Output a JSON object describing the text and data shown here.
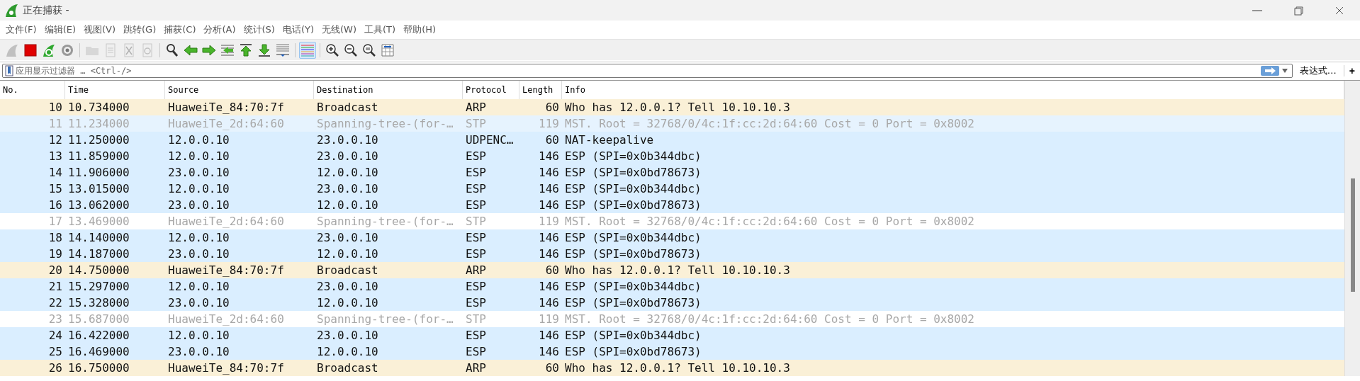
{
  "window": {
    "title": "正在捕获 -"
  },
  "menu": [
    "文件(F)",
    "编辑(E)",
    "视图(V)",
    "跳转(G)",
    "捕获(C)",
    "分析(A)",
    "统计(S)",
    "电话(Y)",
    "无线(W)",
    "工具(T)",
    "帮助(H)"
  ],
  "toolbar": [
    [
      {
        "disabled": true,
        "on": false
      },
      {
        "disabled": false,
        "on": false
      },
      {
        "disabled": false,
        "on": false
      },
      {
        "disabled": false,
        "on": false
      }
    ],
    [
      {
        "disabled": true,
        "on": false
      },
      {
        "disabled": true,
        "on": false
      },
      {
        "disabled": true,
        "on": false
      },
      {
        "disabled": true,
        "on": false
      }
    ],
    [
      {
        "disabled": false,
        "on": false
      },
      {
        "disabled": false,
        "on": false
      },
      {
        "disabled": false,
        "on": false
      },
      {
        "disabled": false,
        "on": false
      },
      {
        "disabled": false,
        "on": false
      },
      {
        "disabled": false,
        "on": false
      },
      {
        "disabled": false,
        "on": false
      }
    ],
    [
      {
        "disabled": false,
        "on": true
      }
    ],
    [
      {
        "disabled": false,
        "on": false
      },
      {
        "disabled": false,
        "on": false
      },
      {
        "disabled": false,
        "on": false
      },
      {
        "disabled": false,
        "on": false
      }
    ]
  ],
  "filter": {
    "placeholder": "应用显示过滤器 … <Ctrl-/>",
    "expression_button": "表达式…",
    "add_button": "+"
  },
  "table": {
    "columns": [
      "No.",
      "Time",
      "Source",
      "Destination",
      "Protocol",
      "Length",
      "Info"
    ],
    "rows": [
      {
        "cells": [
          "10",
          "10.734000",
          "HuaweiTe_84:70:7f",
          "Broadcast",
          "ARP",
          "60",
          "Who has 12.0.0.1? Tell 10.10.10.3"
        ],
        "color": "#faf0d7",
        "dimmed": false
      },
      {
        "cells": [
          "11",
          "11.234000",
          "HuaweiTe_2d:64:60",
          "Spanning-tree-(for-…",
          "STP",
          "119",
          "MST. Root = 32768/0/4c:1f:cc:2d:64:60  Cost = 0  Port = 0x8002"
        ],
        "color": "#e6f3fe",
        "dimmed": true
      },
      {
        "cells": [
          "12",
          "11.250000",
          "12.0.0.10",
          "23.0.0.10",
          "UDPENC…",
          "60",
          "NAT-keepalive"
        ],
        "color": "#daeeff",
        "dimmed": false
      },
      {
        "cells": [
          "13",
          "11.859000",
          "12.0.0.10",
          "23.0.0.10",
          "ESP",
          "146",
          "ESP (SPI=0x0b344dbc)"
        ],
        "color": "#daeeff",
        "dimmed": false
      },
      {
        "cells": [
          "14",
          "11.906000",
          "23.0.0.10",
          "12.0.0.10",
          "ESP",
          "146",
          "ESP (SPI=0x0bd78673)"
        ],
        "color": "#daeeff",
        "dimmed": false
      },
      {
        "cells": [
          "15",
          "13.015000",
          "12.0.0.10",
          "23.0.0.10",
          "ESP",
          "146",
          "ESP (SPI=0x0b344dbc)"
        ],
        "color": "#daeeff",
        "dimmed": false
      },
      {
        "cells": [
          "16",
          "13.062000",
          "23.0.0.10",
          "12.0.0.10",
          "ESP",
          "146",
          "ESP (SPI=0x0bd78673)"
        ],
        "color": "#daeeff",
        "dimmed": false
      },
      {
        "cells": [
          "17",
          "13.469000",
          "HuaweiTe_2d:64:60",
          "Spanning-tree-(for-…",
          "STP",
          "119",
          "MST. Root = 32768/0/4c:1f:cc:2d:64:60  Cost = 0  Port = 0x8002"
        ],
        "color": "#ffffff",
        "dimmed": true
      },
      {
        "cells": [
          "18",
          "14.140000",
          "12.0.0.10",
          "23.0.0.10",
          "ESP",
          "146",
          "ESP (SPI=0x0b344dbc)"
        ],
        "color": "#daeeff",
        "dimmed": false
      },
      {
        "cells": [
          "19",
          "14.187000",
          "23.0.0.10",
          "12.0.0.10",
          "ESP",
          "146",
          "ESP (SPI=0x0bd78673)"
        ],
        "color": "#daeeff",
        "dimmed": false
      },
      {
        "cells": [
          "20",
          "14.750000",
          "HuaweiTe_84:70:7f",
          "Broadcast",
          "ARP",
          "60",
          "Who has 12.0.0.1? Tell 10.10.10.3"
        ],
        "color": "#faf0d7",
        "dimmed": false
      },
      {
        "cells": [
          "21",
          "15.297000",
          "12.0.0.10",
          "23.0.0.10",
          "ESP",
          "146",
          "ESP (SPI=0x0b344dbc)"
        ],
        "color": "#daeeff",
        "dimmed": false
      },
      {
        "cells": [
          "22",
          "15.328000",
          "23.0.0.10",
          "12.0.0.10",
          "ESP",
          "146",
          "ESP (SPI=0x0bd78673)"
        ],
        "color": "#daeeff",
        "dimmed": false
      },
      {
        "cells": [
          "23",
          "15.687000",
          "HuaweiTe_2d:64:60",
          "Spanning-tree-(for-…",
          "STP",
          "119",
          "MST. Root = 32768/0/4c:1f:cc:2d:64:60  Cost = 0  Port = 0x8002"
        ],
        "color": "#ffffff",
        "dimmed": true
      },
      {
        "cells": [
          "24",
          "16.422000",
          "12.0.0.10",
          "23.0.0.10",
          "ESP",
          "146",
          "ESP (SPI=0x0b344dbc)"
        ],
        "color": "#daeeff",
        "dimmed": false
      },
      {
        "cells": [
          "25",
          "16.469000",
          "23.0.0.10",
          "12.0.0.10",
          "ESP",
          "146",
          "ESP (SPI=0x0bd78673)"
        ],
        "color": "#daeeff",
        "dimmed": false
      },
      {
        "cells": [
          "26",
          "16.750000",
          "HuaweiTe_84:70:7f",
          "Broadcast",
          "ARP",
          "60",
          "Who has 12.0.0.1? Tell 10.10.10.3"
        ],
        "color": "#faf0d7",
        "dimmed": false
      }
    ]
  }
}
